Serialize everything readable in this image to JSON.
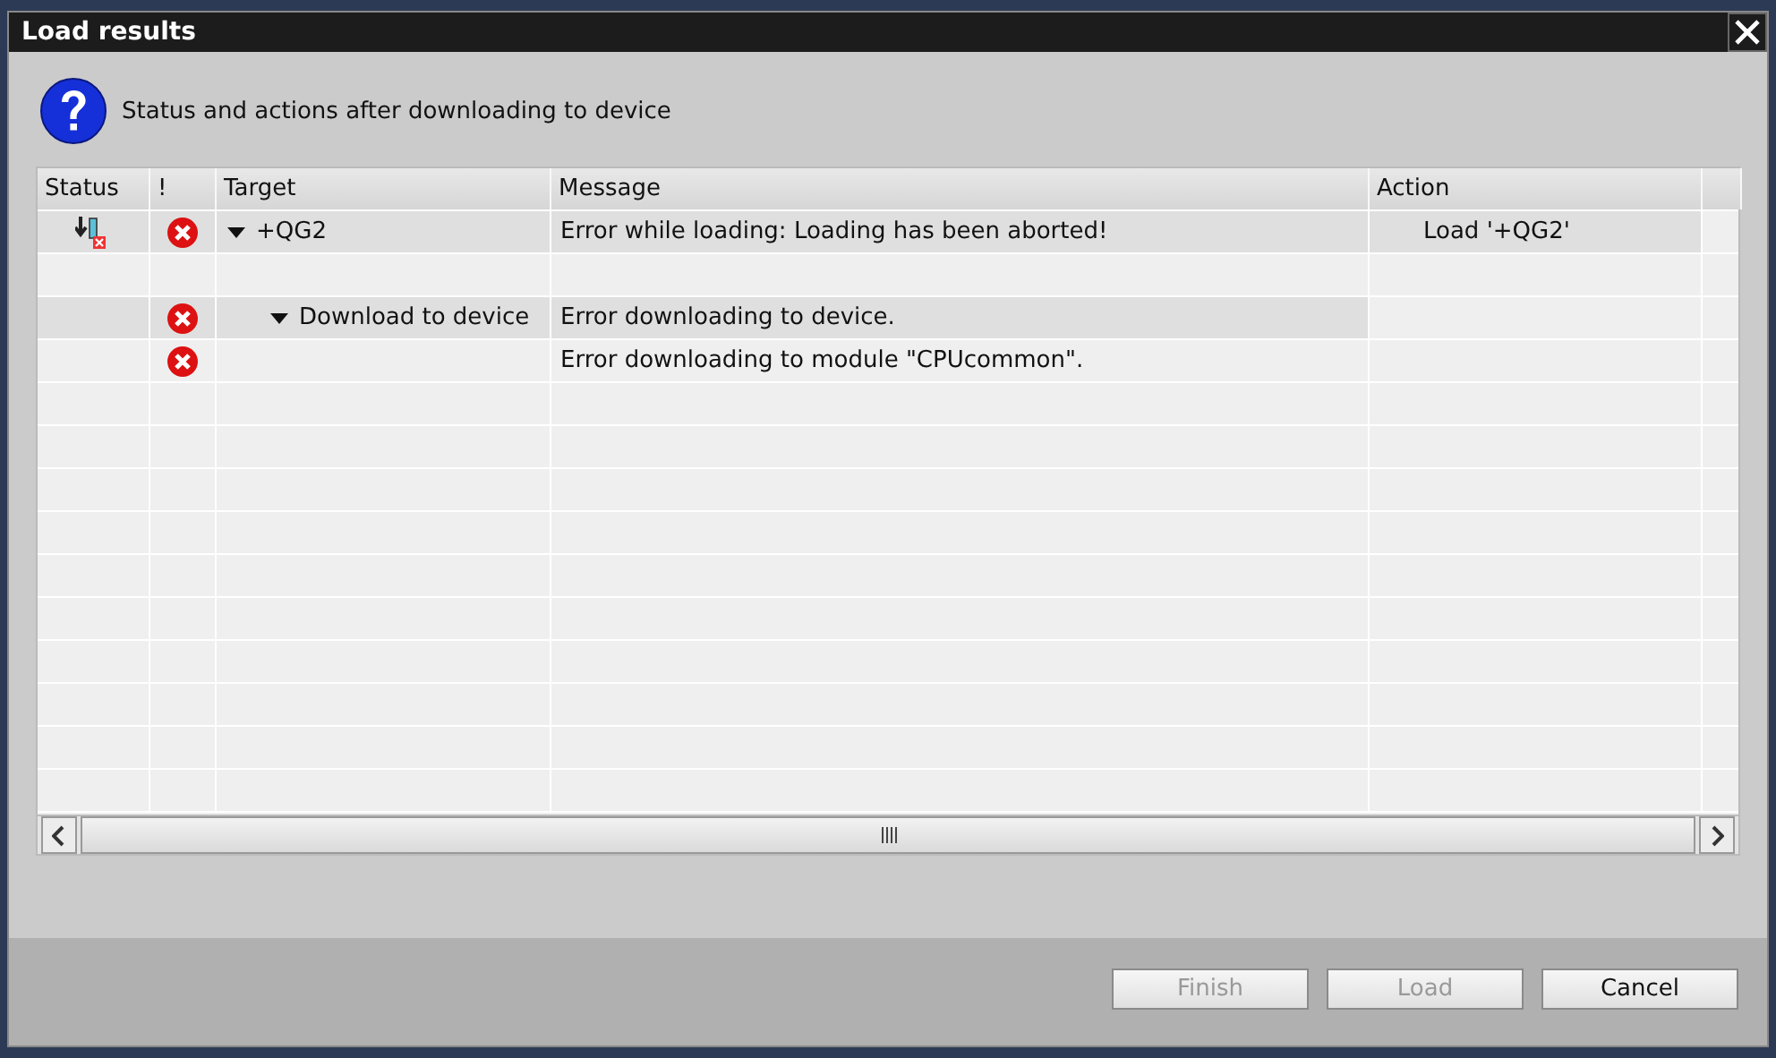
{
  "window": {
    "title": "Load results"
  },
  "header": {
    "text": "Status and actions after downloading to device"
  },
  "table": {
    "columns": [
      "Status",
      "!",
      "Target",
      "Message",
      "Action"
    ],
    "rows": [
      {
        "kind": "download-error",
        "error": true,
        "target": "+QG2",
        "expanded": true,
        "highlighted": true,
        "message": "Error while loading: Loading has been aborted!",
        "action": "Load '+QG2'",
        "children": [
          {
            "error": false,
            "highlighted": false
          },
          {
            "error": true,
            "target": "Download to device",
            "expanded": true,
            "highlighted": true,
            "message": "Error downloading to device.",
            "children": [
              {
                "error": true,
                "highlighted": false,
                "message": "Error downloading to module \"CPUcommon\"."
              }
            ]
          }
        ]
      }
    ]
  },
  "buttons": [
    {
      "label": "Finish",
      "disabled": true
    },
    {
      "label": "Load",
      "disabled": true
    },
    {
      "label": "Cancel",
      "disabled": false
    }
  ]
}
